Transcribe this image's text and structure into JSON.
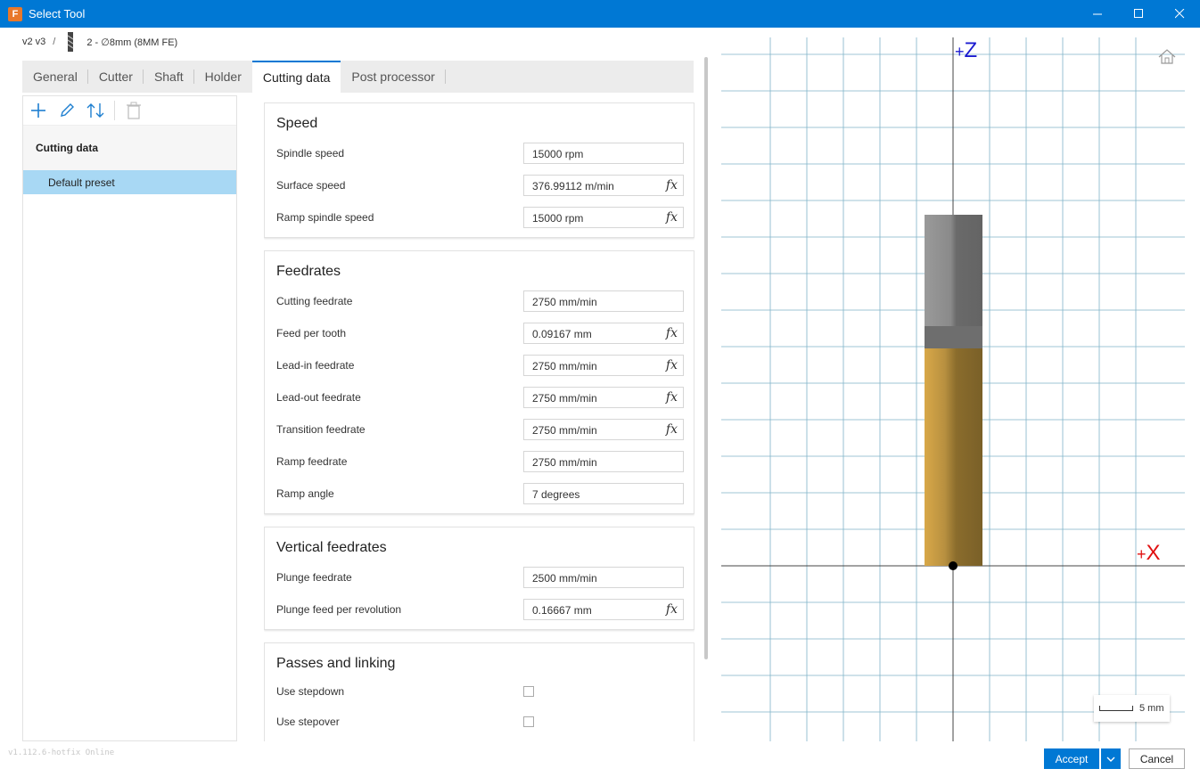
{
  "window": {
    "title": "Select Tool",
    "app_icon_letter": "F"
  },
  "breadcrumb": {
    "version": "v2 v3",
    "separator": "/",
    "tool": "2 - ∅8mm (8MM FE)"
  },
  "tabs": [
    "General",
    "Cutter",
    "Shaft",
    "Holder",
    "Cutting data",
    "Post processor"
  ],
  "active_tab": "Cutting data",
  "left_panel": {
    "heading": "Cutting data",
    "selected_item": "Default preset"
  },
  "sections": {
    "speed": {
      "title": "Speed",
      "rows": [
        {
          "label": "Spindle speed",
          "value": "15000 rpm",
          "fx": false
        },
        {
          "label": "Surface speed",
          "value": "376.99112 m/min",
          "fx": true
        },
        {
          "label": "Ramp spindle speed",
          "value": "15000 rpm",
          "fx": true
        }
      ]
    },
    "feedrates": {
      "title": "Feedrates",
      "rows": [
        {
          "label": "Cutting feedrate",
          "value": "2750 mm/min",
          "fx": false
        },
        {
          "label": "Feed per tooth",
          "value": "0.09167 mm",
          "fx": true
        },
        {
          "label": "Lead-in feedrate",
          "value": "2750 mm/min",
          "fx": true
        },
        {
          "label": "Lead-out feedrate",
          "value": "2750 mm/min",
          "fx": true
        },
        {
          "label": "Transition feedrate",
          "value": "2750 mm/min",
          "fx": true
        },
        {
          "label": "Ramp feedrate",
          "value": "2750 mm/min",
          "fx": false
        },
        {
          "label": "Ramp angle",
          "value": "7 degrees",
          "fx": false
        }
      ]
    },
    "vertical": {
      "title": "Vertical feedrates",
      "rows": [
        {
          "label": "Plunge feedrate",
          "value": "2500 mm/min",
          "fx": false
        },
        {
          "label": "Plunge feed per revolution",
          "value": "0.16667 mm",
          "fx": true
        }
      ]
    },
    "passes": {
      "title": "Passes and linking",
      "rows": [
        {
          "label": "Use stepdown",
          "checked": false
        },
        {
          "label": "Use stepover",
          "checked": false
        }
      ]
    }
  },
  "fx_symbol": "fx",
  "viewport": {
    "z_label": "+Z",
    "x_label": "+X",
    "scale_label": "5 mm",
    "z_color": "#1a1ad0",
    "x_color": "#e01010"
  },
  "footer": {
    "version": "v1.112.6-hotfix Online",
    "accept": "Accept",
    "cancel": "Cancel"
  },
  "colors": {
    "accent": "#0078d4",
    "selected": "#a8d8f4",
    "grid": "#7fb3c8"
  }
}
